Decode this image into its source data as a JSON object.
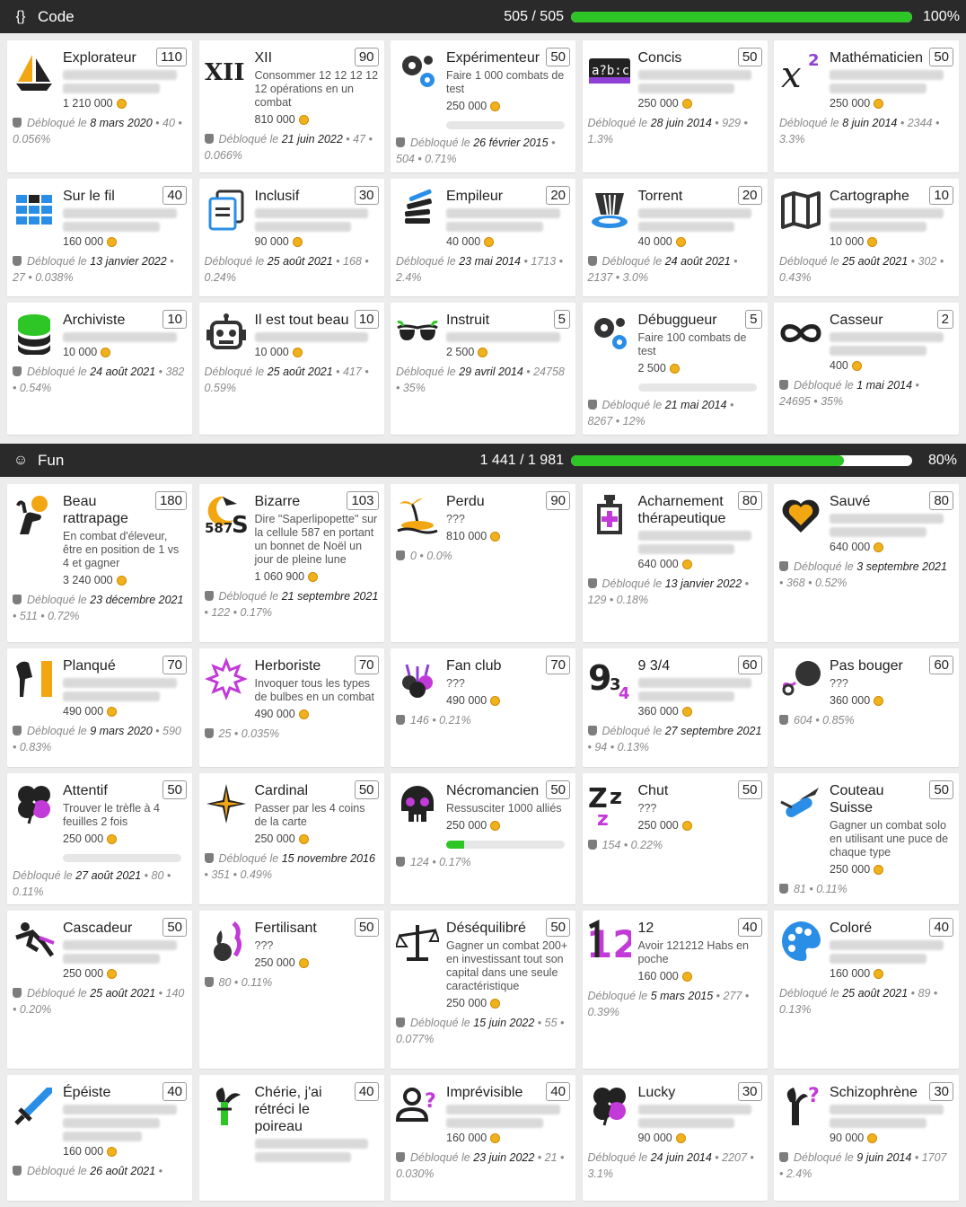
{
  "sections": [
    {
      "id": "code",
      "icon": "braces-icon",
      "title": "Code",
      "count": "505 / 505",
      "progress": 1.0,
      "percent": "100%",
      "cards": [
        {
          "name": "Explorateur",
          "points": "110",
          "icon": "sailboat-icon",
          "desc": "",
          "blur": 2,
          "reward": "1 210 000",
          "prefix": "Débloqué le ",
          "date": "8 mars 2020",
          "suffix": " • 40 • 0.056%"
        },
        {
          "name": "XII",
          "points": "90",
          "icon": "roman-twelve-icon",
          "desc": "Consommer 12 12 12 12 12 opérations en un combat",
          "blur": 0,
          "reward": "810 000",
          "prefix": "Débloqué le ",
          "date": "21 juin 2022",
          "suffix": " • 47 • 0.066%"
        },
        {
          "name": "Expérimenteur",
          "points": "50",
          "icon": "gears-icon",
          "desc": "Faire 1 000 combats de test",
          "blur": 0,
          "reward": "250 000",
          "progress": 0,
          "prefix": "Débloqué le ",
          "date": "26 février 2015",
          "suffix": " • 504 • 0.71%"
        },
        {
          "name": "Concis",
          "points": "50",
          "icon": "abc-code-icon",
          "desc": "",
          "blur": 2,
          "reward": "250 000",
          "prefix": "Débloqué le ",
          "date": "28 juin 2014",
          "suffix": " • 929 • 1.3%",
          "metaPlain": true
        },
        {
          "name": "Mathématicien",
          "points": "50",
          "icon": "math-x-squared-icon",
          "desc": "",
          "blur": 2,
          "reward": "250 000",
          "prefix": "Débloqué le ",
          "date": "8 juin 2014",
          "suffix": " • 2344 • 3.3%",
          "metaPlain": true
        },
        {
          "name": "Sur le fil",
          "points": "40",
          "icon": "bricks-icon",
          "desc": "",
          "blur": 2,
          "reward": "160 000",
          "prefix": "Débloqué le ",
          "date": "13 janvier 2022",
          "suffix": " • 27 • 0.038%"
        },
        {
          "name": "Inclusif",
          "points": "30",
          "icon": "documents-icon",
          "desc": "",
          "blur": 2,
          "reward": "90 000",
          "prefix": "Débloqué le ",
          "date": "25 août 2021",
          "suffix": " • 168 • 0.24%",
          "metaPlain": true
        },
        {
          "name": "Empileur",
          "points": "20",
          "icon": "stack-icon",
          "desc": "",
          "blur": 2,
          "reward": "40 000",
          "prefix": "Débloqué le ",
          "date": "23 mai 2014",
          "suffix": " • 1713 • 2.4%",
          "metaPlain": true
        },
        {
          "name": "Torrent",
          "points": "20",
          "icon": "waterfall-icon",
          "desc": "",
          "blur": 2,
          "reward": "40 000",
          "prefix": "Débloqué le ",
          "date": "24 août 2021",
          "suffix": " • 2137 • 3.0%"
        },
        {
          "name": "Cartographe",
          "points": "10",
          "icon": "map-icon",
          "desc": "",
          "blur": 2,
          "reward": "10 000",
          "prefix": "Débloqué le ",
          "date": "25 août 2021",
          "suffix": " • 302 • 0.43%",
          "metaPlain": true
        },
        {
          "name": "Archiviste",
          "points": "10",
          "icon": "database-icon",
          "desc": "",
          "blur": 1,
          "reward": "10 000",
          "prefix": "Débloqué le ",
          "date": "24 août 2021",
          "suffix": " • 382 • 0.54%"
        },
        {
          "name": "Il est tout beau",
          "points": "10",
          "icon": "robot-icon",
          "desc": "",
          "blur": 1,
          "reward": "10 000",
          "prefix": "Débloqué le ",
          "date": "25 août 2021",
          "suffix": " • 417 • 0.59%",
          "metaPlain": true
        },
        {
          "name": "Instruit",
          "points": "5",
          "icon": "sunglasses-icon",
          "desc": "",
          "blur": 1,
          "reward": "2 500",
          "prefix": "Débloqué le ",
          "date": "29 avril 2014",
          "suffix": " • 24758 • 35%",
          "metaPlain": true
        },
        {
          "name": "Débuggueur",
          "points": "5",
          "icon": "gears-icon",
          "desc": "Faire 100 combats de test",
          "blur": 0,
          "reward": "2 500",
          "progress": 0,
          "prefix": "Débloqué le ",
          "date": "21 mai 2014",
          "suffix": " • 8267 • 12%"
        },
        {
          "name": "Casseur",
          "points": "2",
          "icon": "infinity-icon",
          "desc": "",
          "blur": 2,
          "reward": "400",
          "prefix": "Débloqué le ",
          "date": "1 mai 2014",
          "suffix": " • 24695 • 35%"
        }
      ]
    },
    {
      "id": "fun",
      "icon": "smiley-icon",
      "title": "Fun",
      "count": "1 441 / 1 981",
      "progress": 0.8,
      "percent": "80%",
      "cards": [
        {
          "name": "Beau rattrapage",
          "points": "180",
          "icon": "catch-hand-icon",
          "desc": "En combat d'éleveur, être en position de 1 vs 4 et gagner",
          "blur": 0,
          "reward": "3 240 000",
          "prefix": "Débloqué le ",
          "date": "23 décembre 2021",
          "suffix": " • 511 • 0.72%"
        },
        {
          "name": "Bizarre",
          "points": "103",
          "icon": "moon-587-icon",
          "desc": "Dire \"Saperlipopette\" sur la cellule 587 en portant un bonnet de Noël un jour de pleine lune",
          "blur": 0,
          "reward": "1 060 900",
          "prefix": "Débloqué le ",
          "date": "21 septembre 2021",
          "suffix": " • 122 • 0.17%"
        },
        {
          "name": "Perdu",
          "points": "90",
          "icon": "island-icon",
          "desc": "???",
          "blur": 0,
          "reward": "810 000",
          "prefix": "",
          "date": "",
          "suffix": "0 • 0.0%"
        },
        {
          "name": "Acharnement thérapeutique",
          "points": "80",
          "icon": "medicine-icon",
          "desc": "",
          "blur": 2,
          "reward": "640 000",
          "prefix": "Débloqué le ",
          "date": "13 janvier 2022",
          "suffix": " • 129 • 0.18%"
        },
        {
          "name": "Sauvé",
          "points": "80",
          "icon": "heart-icon",
          "desc": "",
          "blur": 2,
          "reward": "640 000",
          "prefix": "Débloqué le ",
          "date": "3 septembre 2021",
          "suffix": " • 368 • 0.52%"
        },
        {
          "name": "Planqué",
          "points": "70",
          "icon": "hidden-icon",
          "desc": "",
          "blur": 2,
          "reward": "490 000",
          "prefix": "Débloqué le ",
          "date": "9 mars 2020",
          "suffix": " • 590 • 0.83%"
        },
        {
          "name": "Herboriste",
          "points": "70",
          "icon": "leaf-icon",
          "desc": "Invoquer tous les types de bulbes en un combat",
          "blur": 0,
          "reward": "490 000",
          "prefix": "",
          "date": "",
          "suffix": "25 • 0.035%"
        },
        {
          "name": "Fan club",
          "points": "70",
          "icon": "bulbs-icon",
          "desc": "???",
          "blur": 0,
          "reward": "490 000",
          "prefix": "",
          "date": "",
          "suffix": "146 • 0.21%"
        },
        {
          "name": "9 3/4",
          "points": "60",
          "icon": "nine-three-quarters-icon",
          "desc": "",
          "blur": 2,
          "reward": "360 000",
          "prefix": "Débloqué le ",
          "date": "27 septembre 2021",
          "suffix": " • 94 • 0.13%"
        },
        {
          "name": "Pas bouger",
          "points": "60",
          "icon": "ball-chain-icon",
          "desc": "???",
          "blur": 0,
          "reward": "360 000",
          "prefix": "",
          "date": "",
          "suffix": "604 • 0.85%"
        },
        {
          "name": "Attentif",
          "points": "50",
          "icon": "clover-icon",
          "desc": "Trouver le trèfle à 4 feuilles 2 fois",
          "blur": 0,
          "reward": "250 000",
          "progress": 0,
          "prefix": "Débloqué le ",
          "date": "27 août 2021",
          "suffix": " • 80 • 0.11%",
          "metaPlain": true
        },
        {
          "name": "Cardinal",
          "points": "50",
          "icon": "compass-star-icon",
          "desc": "Passer par les 4 coins de la carte",
          "blur": 0,
          "reward": "250 000",
          "prefix": "Débloqué le ",
          "date": "15 novembre 2016",
          "suffix": " • 351 • 0.49%"
        },
        {
          "name": "Nécromancien",
          "points": "50",
          "icon": "skull-icon",
          "desc": "Ressusciter 1000 alliés",
          "blur": 0,
          "reward": "250 000",
          "progress": 0.15,
          "prefix": "",
          "date": "",
          "suffix": "124 • 0.17%"
        },
        {
          "name": "Chut",
          "points": "50",
          "icon": "sleep-z-icon",
          "desc": "???",
          "blur": 0,
          "reward": "250 000",
          "prefix": "",
          "date": "",
          "suffix": "154 • 0.22%"
        },
        {
          "name": "Couteau Suisse",
          "points": "50",
          "icon": "swiss-knife-icon",
          "desc": "Gagner un combat solo en utilisant une puce de chaque type",
          "blur": 0,
          "reward": "250 000",
          "prefix": "",
          "date": "",
          "suffix": "81 • 0.11%"
        },
        {
          "name": "Cascadeur",
          "points": "50",
          "icon": "stuntman-icon",
          "desc": "",
          "blur": 2,
          "reward": "250 000",
          "prefix": "Débloqué le ",
          "date": "25 août 2021",
          "suffix": " • 140 • 0.20%"
        },
        {
          "name": "Fertilisant",
          "points": "50",
          "icon": "fertilizer-icon",
          "desc": "???",
          "blur": 0,
          "reward": "250 000",
          "prefix": "",
          "date": "",
          "suffix": "80 • 0.11%"
        },
        {
          "name": "Déséquilibré",
          "points": "50",
          "icon": "scale-icon",
          "desc": "Gagner un combat 200+ en investissant tout son capital dans une seule caractéristique",
          "blur": 0,
          "reward": "250 000",
          "prefix": "Débloqué le ",
          "date": "15 juin 2022",
          "suffix": " • 55 • 0.077%"
        },
        {
          "name": "12",
          "points": "40",
          "icon": "number-twelve-icon",
          "desc": "Avoir 121212 Habs en poche",
          "blur": 0,
          "reward": "160 000",
          "prefix": "Débloqué le ",
          "date": "5 mars 2015",
          "suffix": " • 277 • 0.39%",
          "metaPlain": true
        },
        {
          "name": "Coloré",
          "points": "40",
          "icon": "palette-icon",
          "desc": "",
          "blur": 2,
          "reward": "160 000",
          "prefix": "Débloqué le ",
          "date": "25 août 2021",
          "suffix": " • 89 • 0.13%",
          "metaPlain": true
        },
        {
          "name": "Épéiste",
          "points": "40",
          "icon": "sword-icon",
          "desc": "",
          "blur": 3,
          "reward": "160 000",
          "prefix": "Débloqué le ",
          "date": "26 août 2021",
          "suffix": " •"
        },
        {
          "name": "Chérie, j'ai rétréci le poireau",
          "points": "40",
          "icon": "leek-icon",
          "desc": "",
          "blur": 2,
          "reward": "",
          "prefix": "",
          "date": "",
          "suffix": ""
        },
        {
          "name": "Imprévisible",
          "points": "40",
          "icon": "user-question-icon",
          "desc": "",
          "blur": 2,
          "reward": "160 000",
          "prefix": "Débloqué le ",
          "date": "23 juin 2022",
          "suffix": " • 21 • 0.030%"
        },
        {
          "name": "Lucky",
          "points": "30",
          "icon": "clover-icon",
          "desc": "",
          "blur": 2,
          "reward": "90 000",
          "prefix": "Débloqué le ",
          "date": "24 juin 2014",
          "suffix": " • 2207 • 3.1%",
          "metaPlain": true
        },
        {
          "name": "Schizophrène",
          "points": "30",
          "icon": "leek-question-icon",
          "desc": "",
          "blur": 2,
          "reward": "90 000",
          "prefix": "Débloqué le ",
          "date": "9 juin 2014",
          "suffix": " • 1707 • 2.4%"
        }
      ]
    }
  ]
}
